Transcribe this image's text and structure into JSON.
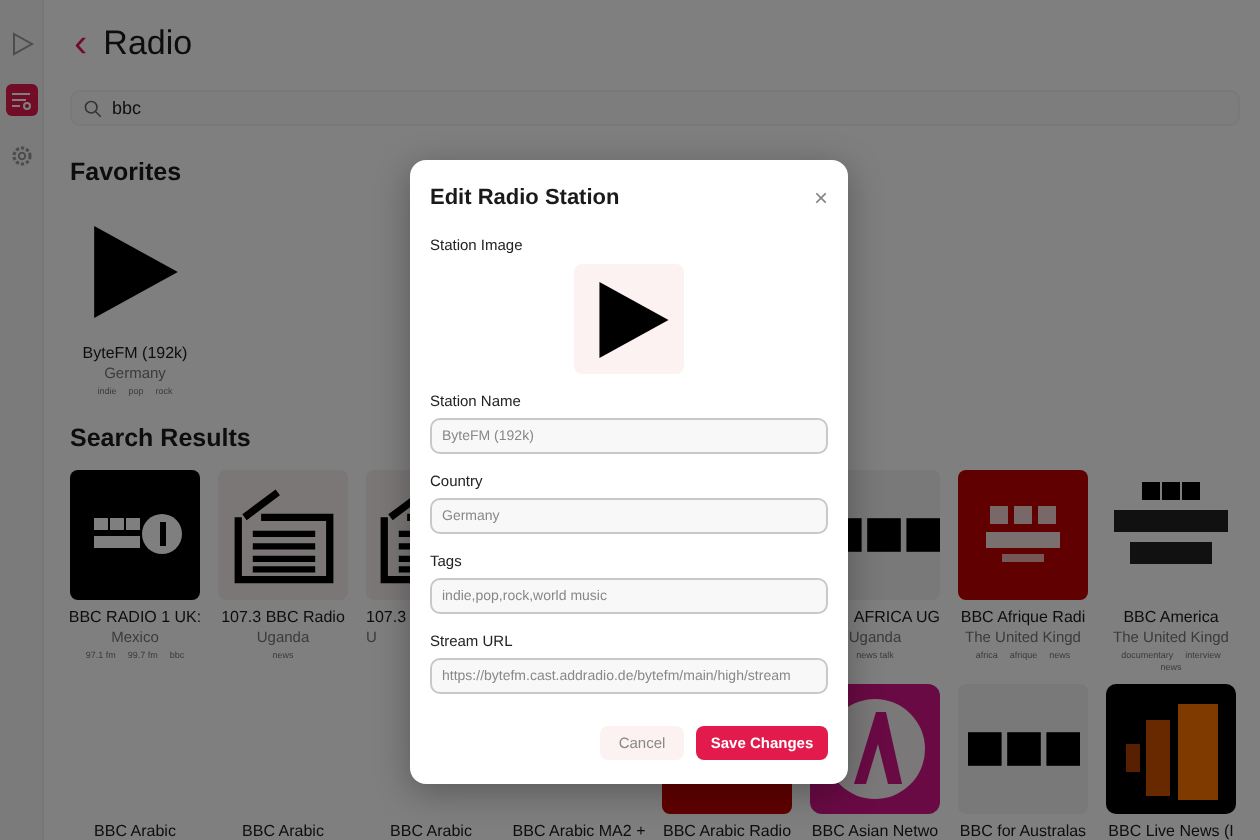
{
  "sidebar": {
    "items": [
      {
        "kind": "player",
        "selected": false
      },
      {
        "kind": "stations",
        "selected": true
      },
      {
        "kind": "settings",
        "selected": false
      }
    ]
  },
  "header": {
    "back": "‹",
    "title": "Radio"
  },
  "search": {
    "value": "bbc"
  },
  "favorites": {
    "heading": "Favorites",
    "stations": [
      {
        "kind": "station",
        "name": "ByteFM (192k)",
        "country": "Germany",
        "tags": [
          "indie",
          "pop",
          "rock"
        ]
      }
    ]
  },
  "results": {
    "heading": "Search Results",
    "stations": [
      {
        "kind": "station",
        "name": "BBC RADIO 1 UK:",
        "country": "Mexico",
        "tags": [
          "97.1 fm",
          "99.7 fm",
          "bbc"
        ]
      },
      {
        "kind": "station",
        "name": "107.3 BBC Radio",
        "country": "Uganda",
        "tags": [
          "news"
        ]
      },
      {
        "kind": "cut-right",
        "name": "107.3",
        "country": "U"
      },
      {
        "kind": "covered"
      },
      {
        "kind": "covered"
      },
      {
        "kind": "cut-left",
        "name": "AFRICA UG",
        "country": "Uganda",
        "tags": [
          "news talk"
        ]
      },
      {
        "kind": "station",
        "name": "BBC Afrique Radi",
        "country": "The United Kingd",
        "tags": [
          "africa",
          "afrique",
          "news"
        ]
      },
      {
        "kind": "station",
        "name": "BBC America",
        "country": "The United Kingd",
        "tags": [
          "documentary",
          "interview",
          "news"
        ]
      },
      {
        "kind": "station",
        "name": "BBC Arabic"
      },
      {
        "kind": "station",
        "name": "BBC Arabic"
      },
      {
        "kind": "station",
        "name": "BBC Arabic"
      },
      {
        "kind": "station",
        "name": "BBC Arabic MA2 +"
      },
      {
        "kind": "station",
        "name": "BBC Arabic Radio"
      },
      {
        "kind": "station",
        "name": "BBC Asian Netwo"
      },
      {
        "kind": "station",
        "name": "BBC for Australas"
      },
      {
        "kind": "station",
        "name": "BBC Live News (I"
      }
    ]
  },
  "dialog": {
    "title": "Edit Radio Station",
    "close": "×",
    "image_label": "Station Image",
    "fields": [
      {
        "label": "Station Name",
        "value": "ByteFM (192k)"
      },
      {
        "label": "Country",
        "value": "Germany"
      },
      {
        "label": "Tags",
        "value": "indie,pop,rock,world music"
      },
      {
        "label": "Stream URL",
        "value": "https://bytefm.cast.addradio.de/bytefm/main/high/stream"
      }
    ],
    "buttons": [
      {
        "kind": "secondary",
        "label": "Cancel"
      },
      {
        "kind": "primary",
        "label": "Save Changes"
      }
    ]
  }
}
